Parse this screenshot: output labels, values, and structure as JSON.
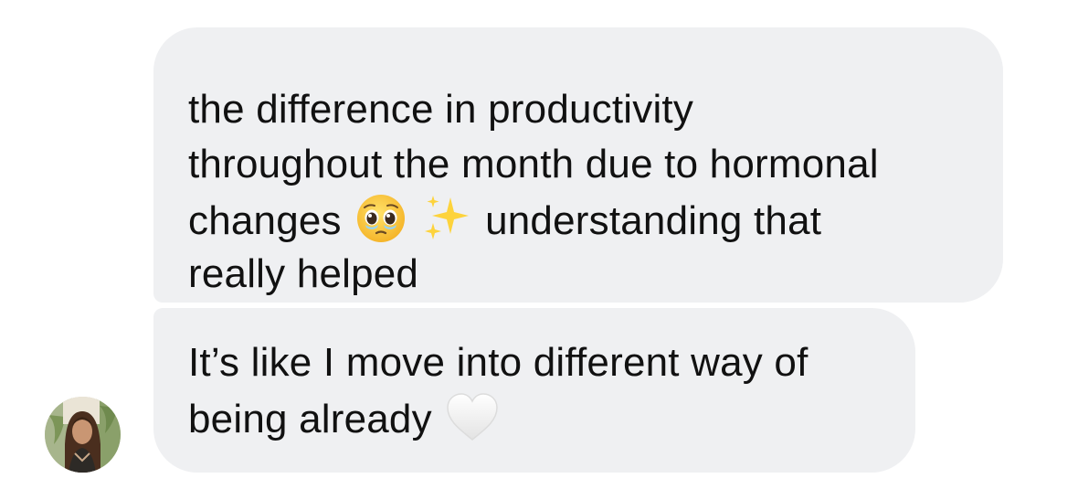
{
  "messages": [
    {
      "lines": [
        "the difference in productivity",
        "throughout the month due to hormonal",
        "changes",
        "understanding that",
        "really helped"
      ],
      "emojis": [
        "pleading-face-emoji",
        "sparkles-emoji"
      ]
    },
    {
      "lines": [
        "It’s like I move into different way of",
        "being already"
      ],
      "emojis": [
        "white-heart-emoji"
      ]
    }
  ],
  "colors": {
    "bubble_background": "#eff0f2",
    "text": "#111111",
    "emoji_face": "#ffc83d",
    "sparkle": "#fdd33c",
    "heart": "#f4f4f4"
  },
  "avatar": {
    "icon": "contact-profile-photo"
  }
}
